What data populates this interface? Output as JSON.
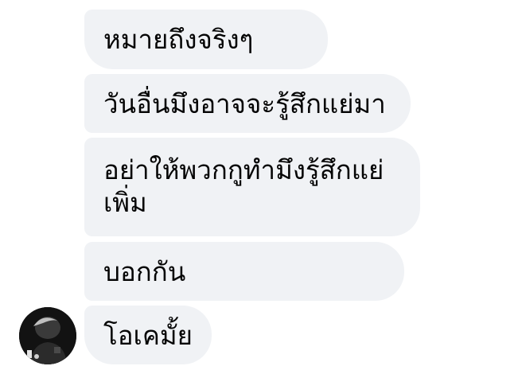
{
  "messages": [
    "หมายถึงจริงๆ",
    "วันอื่นมึงอาจจะรู้สึกแย่มา",
    "อย่าให้พวกกูทำมึงรู้สึกแย่เพิ่ม",
    "บอกกัน",
    "โอเคมั้ย"
  ],
  "colors": {
    "bubble_bg": "#f0f2f5",
    "text": "#050505",
    "avatar_bg": "#121212"
  }
}
